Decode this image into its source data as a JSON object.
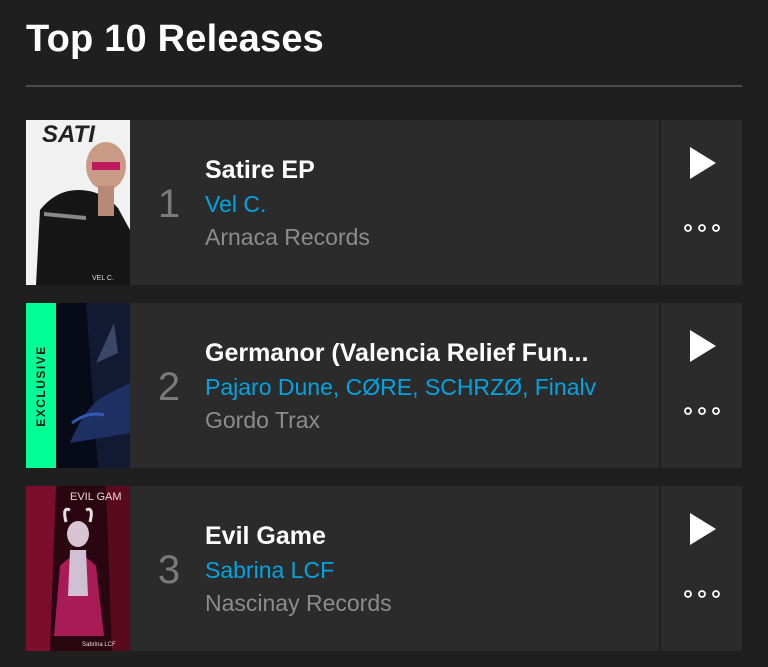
{
  "section": {
    "title": "Top 10 Releases"
  },
  "colors": {
    "background": "#1f1f1f",
    "card": "#2b2b2b",
    "artist_link": "#01a4e1",
    "exclusive_badge": "#01ff95"
  },
  "releases": [
    {
      "rank": "1",
      "title": "Satire EP",
      "artists": "Vel C.",
      "label": "Arnaca Records",
      "artwork_text": "SATI",
      "artwork_caption": "VEL C.",
      "exclusive": false
    },
    {
      "rank": "2",
      "title": "Germanor (Valencia Relief Fun...",
      "artists": "Pajaro Dune, CØRE, SCHRZØ, Finalv",
      "label": "Gordo Trax",
      "exclusive": true,
      "badge": "EXCLUSIVE"
    },
    {
      "rank": "3",
      "title": "Evil Game",
      "artists": "Sabrina LCF",
      "label": "Nascinay Records",
      "artwork_text": "EVIL GAM",
      "artwork_caption": "Sabrina LCF",
      "exclusive": false
    }
  ],
  "icons": {
    "play": "play-icon",
    "more": "more-icon"
  }
}
